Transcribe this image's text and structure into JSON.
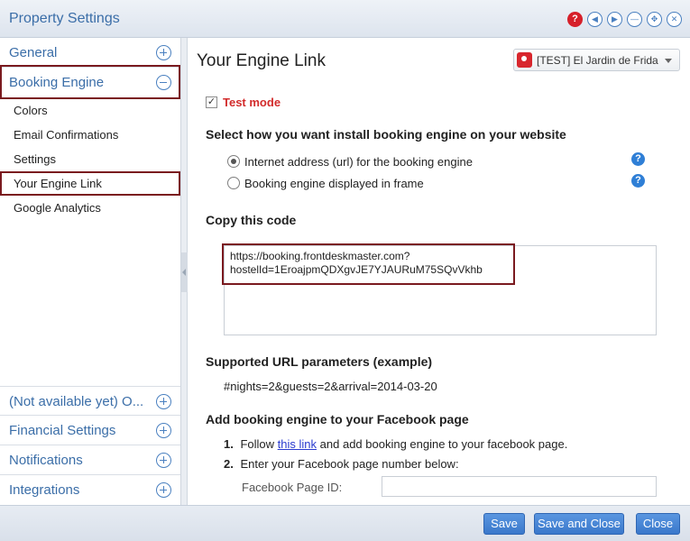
{
  "window": {
    "title": "Property Settings",
    "controls": [
      {
        "name": "help-icon",
        "glyph": "?"
      },
      {
        "name": "prev-icon",
        "glyph": "◀"
      },
      {
        "name": "next-icon",
        "glyph": "▶"
      },
      {
        "name": "minimize-icon",
        "glyph": "—"
      },
      {
        "name": "maximize-icon",
        "glyph": "✥"
      },
      {
        "name": "close-icon",
        "glyph": "✕"
      }
    ]
  },
  "sidebar": {
    "sections": [
      {
        "label": "General",
        "expanded": false
      },
      {
        "label": "Booking Engine",
        "expanded": true
      },
      {
        "label": "(Not available yet) O...",
        "expanded": false
      },
      {
        "label": "Financial Settings",
        "expanded": false
      },
      {
        "label": "Notifications",
        "expanded": false
      },
      {
        "label": "Integrations",
        "expanded": false
      }
    ],
    "booking_engine_items": [
      "Colors",
      "Email Confirmations",
      "Settings",
      "Your Engine Link",
      "Google Analytics"
    ],
    "active_item": "Your Engine Link"
  },
  "main": {
    "title": "Your Engine Link",
    "property_select": {
      "value": "[TEST] El Jardin de Frida"
    },
    "test_mode": {
      "label": "Test mode",
      "checked": true,
      "check_glyph": "✓"
    },
    "install": {
      "heading": "Select how you want install booking engine on your website",
      "options": [
        {
          "label": "Internet address (url) for the booking engine",
          "checked": true
        },
        {
          "label": "Booking engine displayed in frame",
          "checked": false
        }
      ],
      "help_glyph": "?"
    },
    "copy": {
      "heading": "Copy this code",
      "line1": "https://booking.frontdeskmaster.com?",
      "line2": "hostelId=1EroajpmQDXgvJE7YJAURuM75SQvVkhb"
    },
    "params": {
      "heading": "Supported URL parameters (example)",
      "example": "#nights=2&guests=2&arrival=2014-03-20"
    },
    "facebook": {
      "heading": "Add booking engine to your Facebook page",
      "step1_num": "1.",
      "step1_pre": "Follow",
      "step1_link": "this link",
      "step1_post": "and add booking engine to your facebook page.",
      "step2_num": "2.",
      "step2_text": "Enter your Facebook page number below:",
      "page_id_label": "Facebook Page ID:",
      "page_id_value": ""
    }
  },
  "footer": {
    "save": "Save",
    "save_close": "Save and Close",
    "close": "Close"
  }
}
